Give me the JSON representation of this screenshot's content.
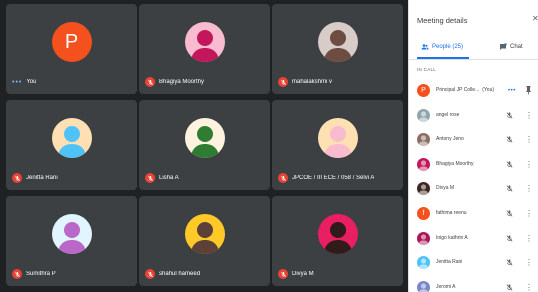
{
  "grid": {
    "tiles": [
      {
        "name": "You",
        "status": "speaking-dots",
        "avatar": {
          "type": "letter",
          "letter": "P",
          "color": "#f4511e"
        }
      },
      {
        "name": "Bhagiya Moorthy",
        "status": "muted",
        "avatar": {
          "type": "image",
          "icon": "teddy-bears-photo",
          "colors": [
            "#c2185b",
            "#f8bbd0"
          ]
        }
      },
      {
        "name": "mahalakshmi v",
        "status": "muted",
        "avatar": {
          "type": "image",
          "icon": "chess-pieces-photo",
          "colors": [
            "#6d4c41",
            "#d7ccc8"
          ]
        }
      },
      {
        "name": "Jenitta Rani",
        "status": "muted",
        "avatar": {
          "type": "image",
          "icon": "girl-beach-photo",
          "colors": [
            "#4fc3f7",
            "#ffe0b2"
          ]
        }
      },
      {
        "name": "Lisha A",
        "status": "muted",
        "avatar": {
          "type": "image",
          "icon": "boy-plants-photo",
          "colors": [
            "#2e7d32",
            "#fff3e0"
          ]
        }
      },
      {
        "name": "JPCOE / III ECE / 058 / Selvi A",
        "status": "muted",
        "avatar": {
          "type": "image",
          "icon": "baby-photo",
          "colors": [
            "#f8bbd0",
            "#ffe0b2"
          ]
        }
      },
      {
        "name": "Sumithra P",
        "status": "muted",
        "avatar": {
          "type": "image",
          "icon": "flowers-photo",
          "colors": [
            "#ba68c8",
            "#e1f5fe"
          ]
        }
      },
      {
        "name": "shahul hameed",
        "status": "muted",
        "avatar": {
          "type": "image",
          "icon": "man-outdoor-photo",
          "colors": [
            "#5d4037",
            "#ffca28"
          ]
        }
      },
      {
        "name": "Divya M",
        "status": "muted",
        "avatar": {
          "type": "image",
          "icon": "divya-text-logo",
          "colors": [
            "#311b1b",
            "#e91e63"
          ]
        }
      }
    ]
  },
  "panel": {
    "title": "Meeting details",
    "close_icon": "close-icon",
    "tabs": [
      {
        "label": "People (25)",
        "icon": "people-icon",
        "selected": true
      },
      {
        "label": "Chat",
        "icon": "chat-icon",
        "selected": false
      }
    ],
    "section_label": "IN CALL",
    "participants": [
      {
        "name": "Principal JP Colle...",
        "suffix": "(You)",
        "avatar_letter": "P",
        "avatar_color": "#f4511e",
        "state": "speaking-dots"
      },
      {
        "name": "angel rose",
        "avatar_color": "#90a4ae",
        "state": "muted"
      },
      {
        "name": "Antony Jeno",
        "avatar_color": "#8d6e63",
        "state": "muted"
      },
      {
        "name": "Bhagiya Moorthy",
        "avatar_color": "#c2185b",
        "state": "muted"
      },
      {
        "name": "Divya M",
        "avatar_color": "#3e2723",
        "state": "muted"
      },
      {
        "name": "fathima reenu",
        "avatar_letter": "f",
        "avatar_color": "#f4511e",
        "state": "muted"
      },
      {
        "name": "Inigo kathrin A",
        "avatar_color": "#ad1457",
        "state": "muted"
      },
      {
        "name": "Jenitta Rani",
        "avatar_color": "#4fc3f7",
        "state": "muted"
      },
      {
        "name": "Jeromi A",
        "avatar_color": "#7986cb",
        "state": "muted"
      }
    ]
  }
}
